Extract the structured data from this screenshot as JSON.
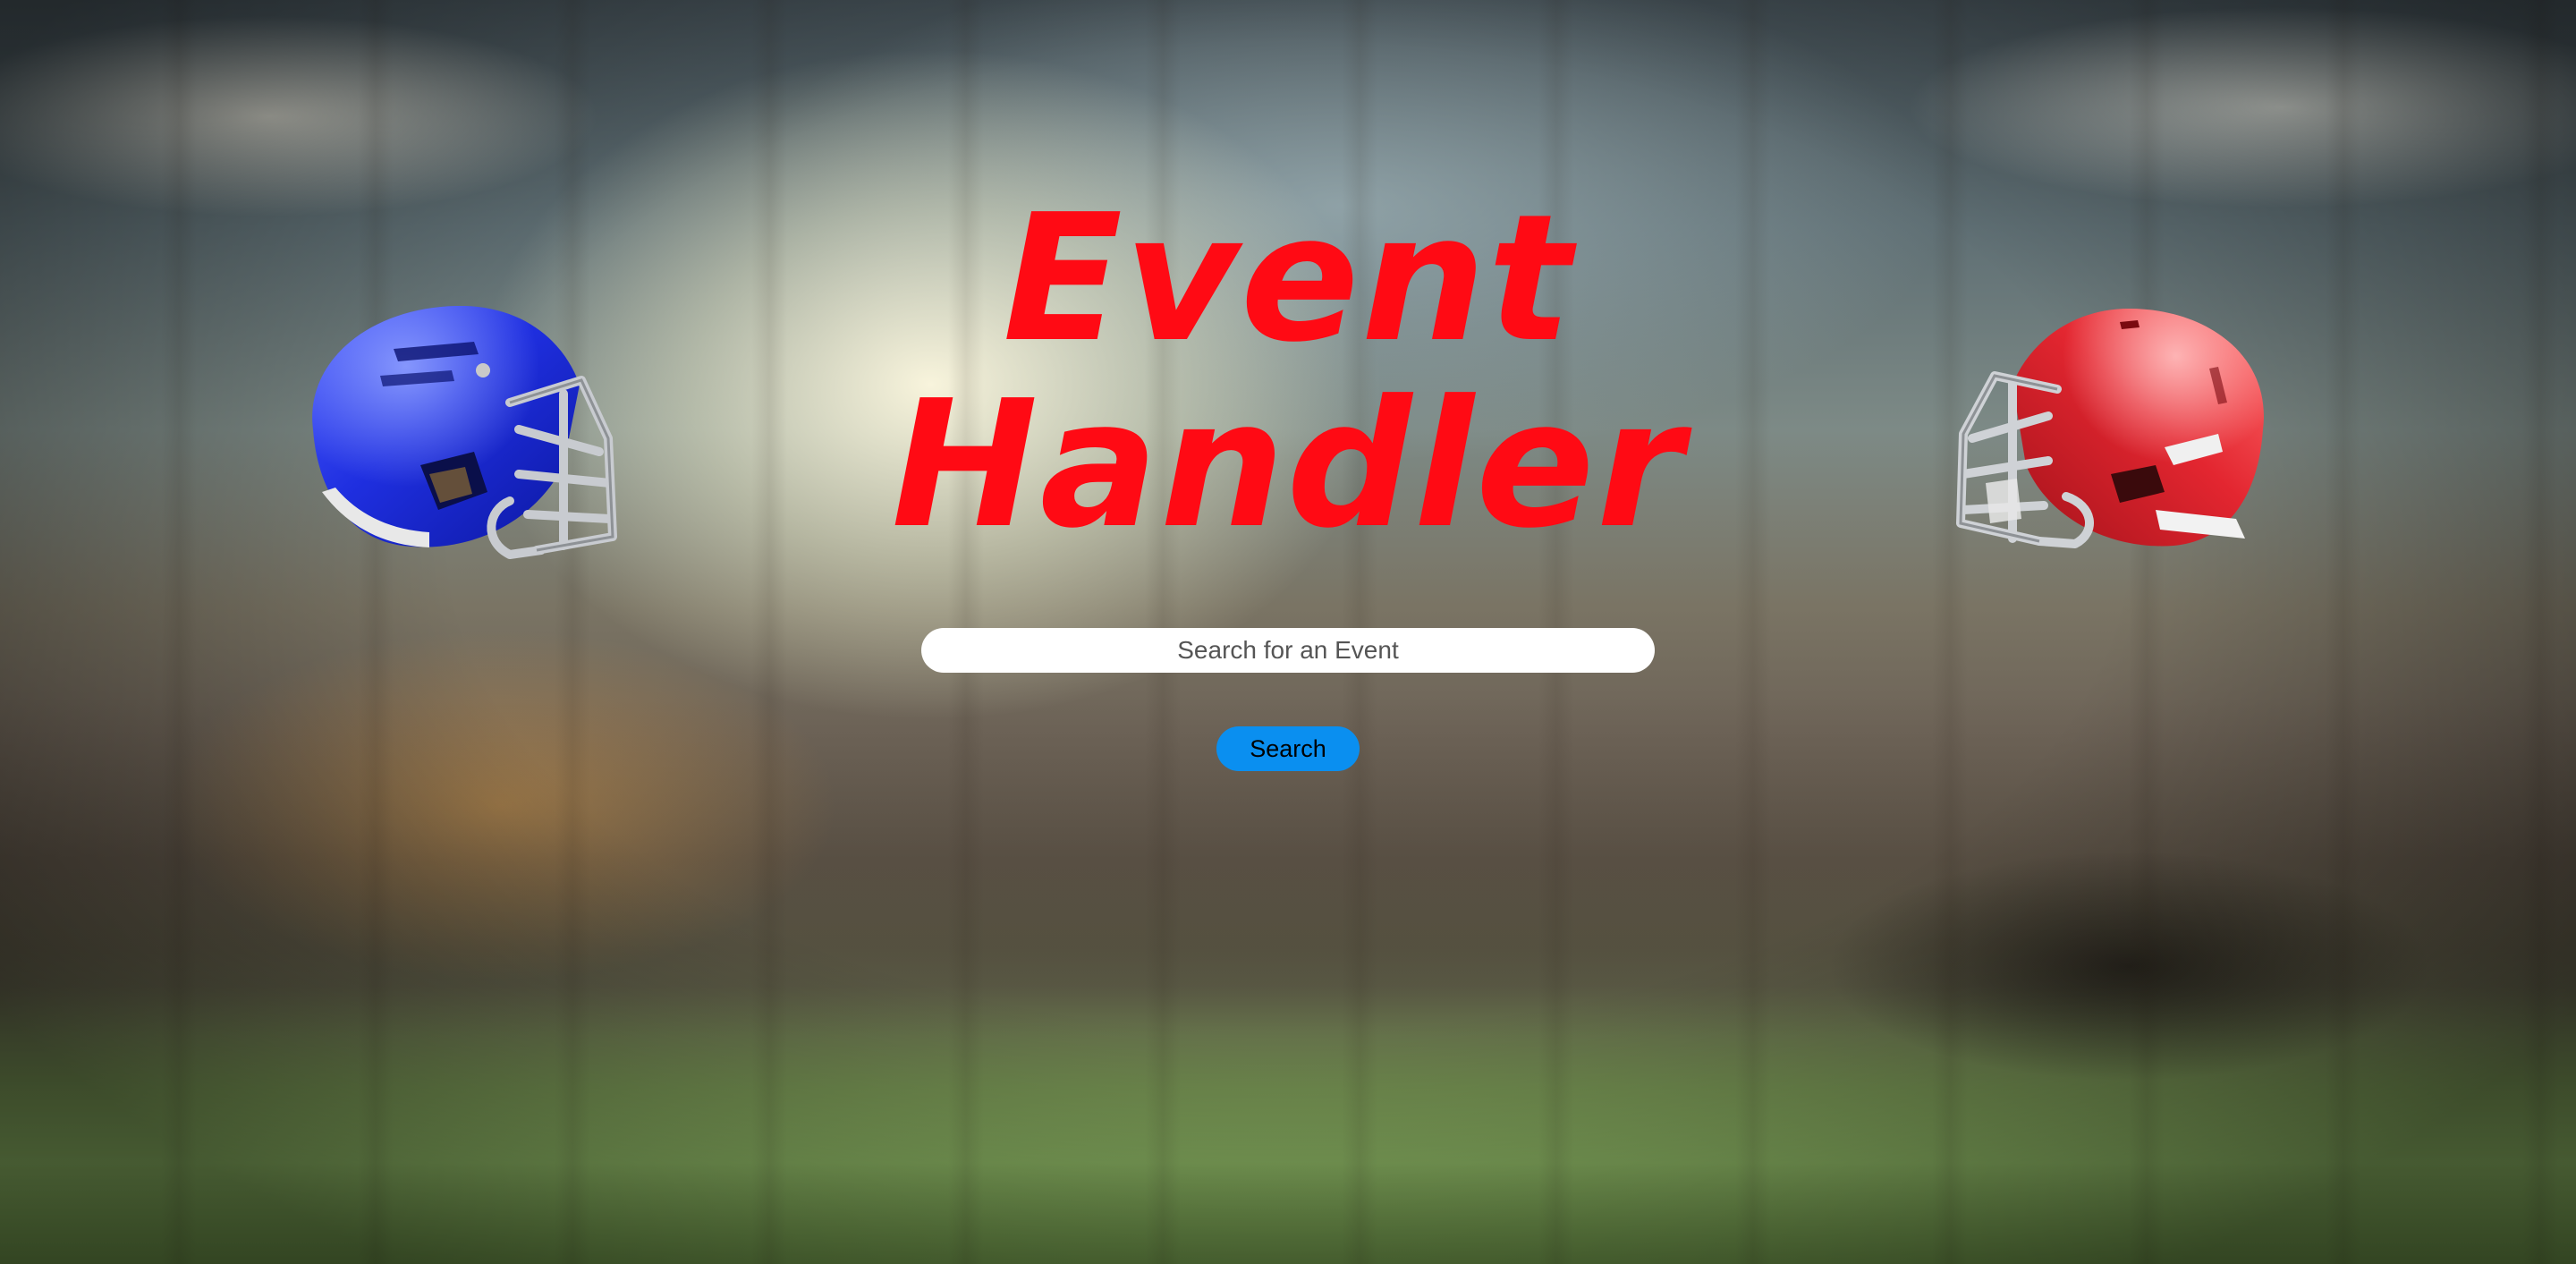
{
  "app": {
    "title_line1": "Event",
    "title_line2": "Handler",
    "accent_color": "#ff0a14"
  },
  "search": {
    "placeholder": "Search for an Event",
    "value": "",
    "button_label": "Search",
    "button_color": "#0a8ff0"
  },
  "decor": {
    "left_image": "blue-football-helmet",
    "right_image": "red-football-helmet",
    "background": "blurred-football-stadium"
  }
}
